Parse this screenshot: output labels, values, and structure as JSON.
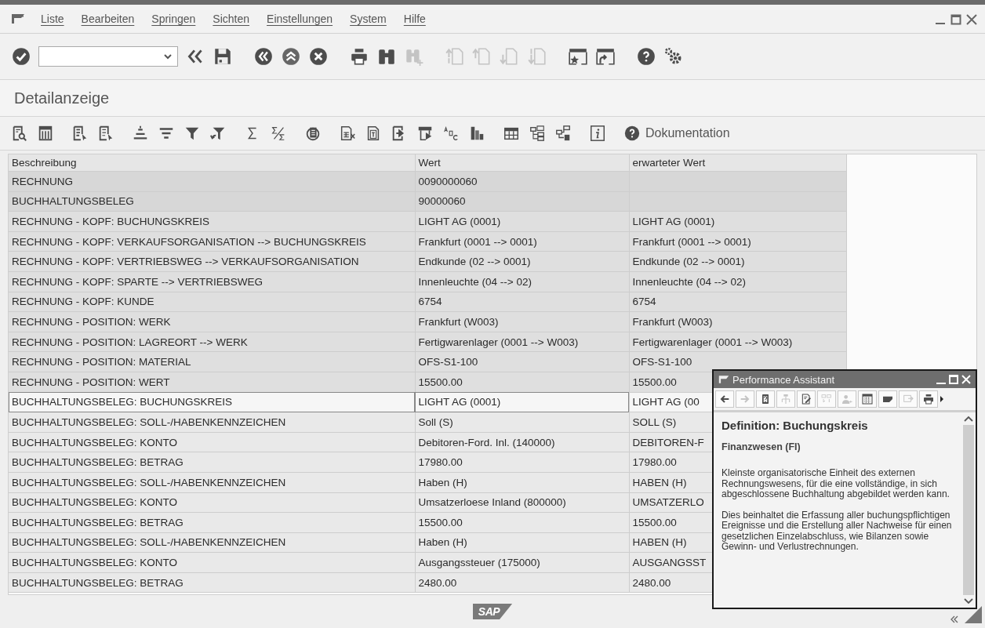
{
  "menu_bar": {
    "items": [
      {
        "label": "Liste"
      },
      {
        "label": "Bearbeiten"
      },
      {
        "label": "Springen"
      },
      {
        "label": "Sichten"
      },
      {
        "label": "Einstellungen"
      },
      {
        "label": "System"
      },
      {
        "label": "Hilfe"
      }
    ]
  },
  "system_toolbar": {
    "groups": [
      {
        "buttons": [
          {
            "kind": "enter",
            "disabled": false
          },
          {
            "kind": "command_field"
          },
          {
            "kind": "chevrons",
            "disabled": false
          },
          {
            "kind": "save",
            "disabled": false
          }
        ]
      },
      {
        "buttons": [
          {
            "kind": "back",
            "disabled": false
          },
          {
            "kind": "exit",
            "disabled": false
          },
          {
            "kind": "cancel",
            "disabled": false
          }
        ]
      },
      {
        "buttons": [
          {
            "kind": "print",
            "disabled": false
          },
          {
            "kind": "find",
            "disabled": false
          },
          {
            "kind": "find_next",
            "disabled": true
          }
        ]
      },
      {
        "buttons": [
          {
            "kind": "first_page",
            "disabled": true
          },
          {
            "kind": "prev_page",
            "disabled": true
          },
          {
            "kind": "next_page",
            "disabled": true
          },
          {
            "kind": "last_page",
            "disabled": true
          }
        ]
      },
      {
        "buttons": [
          {
            "kind": "new_session",
            "disabled": false
          },
          {
            "kind": "shortcut",
            "disabled": false
          }
        ]
      },
      {
        "buttons": [
          {
            "kind": "help",
            "disabled": false
          },
          {
            "kind": "settings",
            "disabled": false
          }
        ]
      }
    ]
  },
  "screen_title": "Detailanzeige",
  "application_toolbar": {
    "groups": [
      {
        "buttons": [
          {
            "kind": "doc_search",
            "disabled": false
          },
          {
            "kind": "columns",
            "disabled": false
          }
        ]
      },
      {
        "buttons": [
          {
            "kind": "select",
            "disabled": false
          },
          {
            "kind": "deselect",
            "disabled": false
          }
        ]
      },
      {
        "buttons": [
          {
            "kind": "sort_up",
            "disabled": false
          },
          {
            "kind": "sort_down",
            "disabled": false
          },
          {
            "kind": "filter",
            "disabled": false
          },
          {
            "kind": "filter_off",
            "disabled": false
          }
        ]
      },
      {
        "buttons": [
          {
            "kind": "sum",
            "disabled": false
          },
          {
            "kind": "subtotal",
            "disabled": false
          }
        ]
      },
      {
        "buttons": [
          {
            "kind": "stack",
            "disabled": false
          }
        ]
      },
      {
        "buttons": [
          {
            "kind": "spreadsheet",
            "disabled": false
          },
          {
            "kind": "text_doc",
            "disabled": false
          },
          {
            "kind": "export",
            "disabled": false
          },
          {
            "kind": "layout",
            "disabled": false
          },
          {
            "kind": "font",
            "disabled": false
          },
          {
            "kind": "bar_chart",
            "disabled": false
          }
        ]
      },
      {
        "buttons": [
          {
            "kind": "grid",
            "disabled": false
          },
          {
            "kind": "tree",
            "disabled": false
          },
          {
            "kind": "tree_save",
            "disabled": false
          }
        ]
      },
      {
        "buttons": [
          {
            "kind": "info",
            "disabled": false
          }
        ]
      },
      {
        "buttons": [
          {
            "kind": "text_button",
            "label": "Dokumentation",
            "disabled": false
          }
        ]
      }
    ]
  },
  "table": {
    "columns": [
      "Beschreibung",
      "Wert",
      "erwarteter Wert"
    ],
    "rows": [
      {
        "kind": "key",
        "selected": false,
        "cells": [
          "RECHNUNG",
          "0090000060"
        ]
      },
      {
        "kind": "key",
        "selected": false,
        "cells": [
          "BUCHHALTUNGSBELEG",
          "90000060"
        ]
      },
      {
        "kind": "invoice",
        "selected": false,
        "cells": [
          "RECHNUNG - KOPF: BUCHUNGSKREIS",
          "LIGHT AG (0001)",
          "LIGHT AG (0001)"
        ]
      },
      {
        "kind": "invoice",
        "selected": false,
        "cells": [
          "RECHNUNG - KOPF: VERKAUFSORGANISATION --> BUCHUNGSKREIS",
          "Frankfurt (0001 --> 0001)",
          "Frankfurt (0001 --> 0001)"
        ]
      },
      {
        "kind": "invoice",
        "selected": false,
        "cells": [
          "RECHNUNG - KOPF: VERTRIEBSWEG --> VERKAUFSORGANISATION",
          "Endkunde (02 --> 0001)",
          "Endkunde (02 --> 0001)"
        ]
      },
      {
        "kind": "invoice",
        "selected": false,
        "cells": [
          "RECHNUNG - KOPF: SPARTE --> VERTRIEBSWEG",
          "Innenleuchte (04 --> 02)",
          "Innenleuchte (04 --> 02)"
        ]
      },
      {
        "kind": "invoice",
        "selected": false,
        "cells": [
          "RECHNUNG - KOPF: KUNDE",
          "6754",
          "6754"
        ]
      },
      {
        "kind": "invoice",
        "selected": false,
        "cells": [
          "RECHNUNG - POSITION: WERK",
          "Frankfurt (W003)",
          "Frankfurt (W003)"
        ]
      },
      {
        "kind": "invoice",
        "selected": false,
        "cells": [
          "RECHNUNG - POSITION: LAGREORT --> WERK",
          "Fertigwarenlager (0001 --> W003)",
          "Fertigwarenlager (0001 --> W003)"
        ]
      },
      {
        "kind": "invoice",
        "selected": false,
        "cells": [
          "RECHNUNG - POSITION: MATERIAL",
          "OFS-S1-100",
          "OFS-S1-100"
        ]
      },
      {
        "kind": "invoice",
        "selected": false,
        "cells": [
          "RECHNUNG - POSITION: WERT",
          "15500.00",
          "15500.00"
        ]
      },
      {
        "kind": "document",
        "selected": true,
        "cells": [
          "BUCHHALTUNGSBELEG: BUCHUNGSKREIS",
          "LIGHT AG (0001)",
          "LIGHT AG (00"
        ]
      },
      {
        "kind": "document",
        "selected": false,
        "cells": [
          "BUCHHALTUNGSBELEG: SOLL-/HABENKENNZEICHEN",
          "Soll (S)",
          "SOLL (S)"
        ]
      },
      {
        "kind": "document",
        "selected": false,
        "cells": [
          "BUCHHALTUNGSBELEG: KONTO",
          "Debitoren-Ford. Inl. (140000)",
          "DEBITOREN-F"
        ]
      },
      {
        "kind": "document",
        "selected": false,
        "cells": [
          "BUCHHALTUNGSBELEG: BETRAG",
          "17980.00",
          "17980.00"
        ]
      },
      {
        "kind": "document",
        "selected": false,
        "cells": [
          "BUCHHALTUNGSBELEG: SOLL-/HABENKENNZEICHEN",
          "Haben (H)",
          "HABEN (H)"
        ]
      },
      {
        "kind": "document",
        "selected": false,
        "cells": [
          "BUCHHALTUNGSBELEG: KONTO",
          "Umsatzerloese Inland (800000)",
          "UMSATZERLO"
        ]
      },
      {
        "kind": "document",
        "selected": false,
        "cells": [
          "BUCHHALTUNGSBELEG: BETRAG",
          "15500.00",
          "15500.00"
        ]
      },
      {
        "kind": "document",
        "selected": false,
        "cells": [
          "BUCHHALTUNGSBELEG: SOLL-/HABENKENNZEICHEN",
          "Haben (H)",
          "HABEN (H)"
        ]
      },
      {
        "kind": "document",
        "selected": false,
        "cells": [
          "BUCHHALTUNGSBELEG: KONTO",
          "Ausgangssteuer (175000)",
          "AUSGANGSST"
        ]
      },
      {
        "kind": "document",
        "selected": false,
        "cells": [
          "BUCHHALTUNGSBELEG: BETRAG",
          "2480.00",
          "2480.00"
        ]
      }
    ]
  },
  "performance_assistant": {
    "title": "Performance Assistant",
    "toolbar": [
      {
        "kind": "back",
        "disabled": false
      },
      {
        "kind": "forward",
        "disabled": true
      },
      {
        "kind": "clipboard",
        "disabled": false
      },
      {
        "kind": "hierarchy",
        "disabled": true
      },
      {
        "kind": "edit",
        "disabled": false
      },
      {
        "kind": "note",
        "disabled": true
      },
      {
        "kind": "person",
        "disabled": true
      },
      {
        "kind": "calendar",
        "disabled": false
      },
      {
        "kind": "folder",
        "disabled": false
      },
      {
        "kind": "export",
        "disabled": true
      },
      {
        "kind": "print",
        "disabled": false
      }
    ],
    "heading": "Definition: Buchungskreis",
    "subheading": "Finanzwesen (FI)",
    "paragraphs": [
      "Kleinste organisatorische Einheit des externen Rechnungswesens, für die eine vollständige, in sich abgeschlossene Buchhaltung abgebildet werden kann.",
      "Dies beinhaltet die Erfassung aller buchungspflichtigen Ereignisse und die Erstellung aller Nachweise für einen gesetzlichen Einzelabschluss, wie Bilanzen sowie Gewinn- und Verlustrechnungen."
    ]
  },
  "status_bar": {
    "logo": "SAP"
  }
}
